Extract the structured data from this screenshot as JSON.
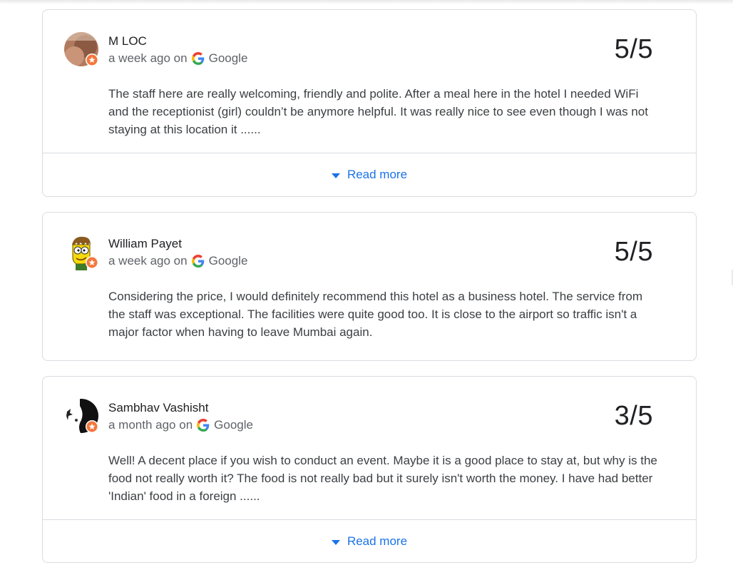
{
  "reviews": [
    {
      "author": "M LOC",
      "time": "a week ago on",
      "source": "Google",
      "rating": "5/5",
      "text": "The staff here are really welcoming, friendly and polite. After a meal here in the hotel I needed WiFi and the receptionist (girl) couldn’t be anymore helpful. It was really nice to see even though I was not staying at this location it ......",
      "read_more": "Read more"
    },
    {
      "author": "William Payet",
      "time": "a week ago on",
      "source": "Google",
      "rating": "5/5",
      "text": "Considering the price, I would definitely recommend this hotel as a business hotel. The service from the staff was exceptional. The facilities were quite good too. It is close to the airport so traffic isn't a major factor when having to leave Mumbai again."
    },
    {
      "author": "Sambhav Vashisht",
      "time": "a month ago on",
      "source": "Google",
      "rating": "3/5",
      "text": "Well! A decent place if you wish to conduct an event. Maybe it is a good place to stay at, but why is the food not really worth it? The food is not really bad but it surely isn't worth the money. I have had better 'Indian' food in a foreign ......",
      "read_more": "Read more"
    }
  ],
  "colors": {
    "link": "#1a73e8",
    "badge": "#f4763a",
    "border": "#dadce0"
  },
  "icons": {
    "source": "google-g-icon",
    "expand": "caret-down-icon",
    "badge": "local-guide-badge-icon"
  }
}
